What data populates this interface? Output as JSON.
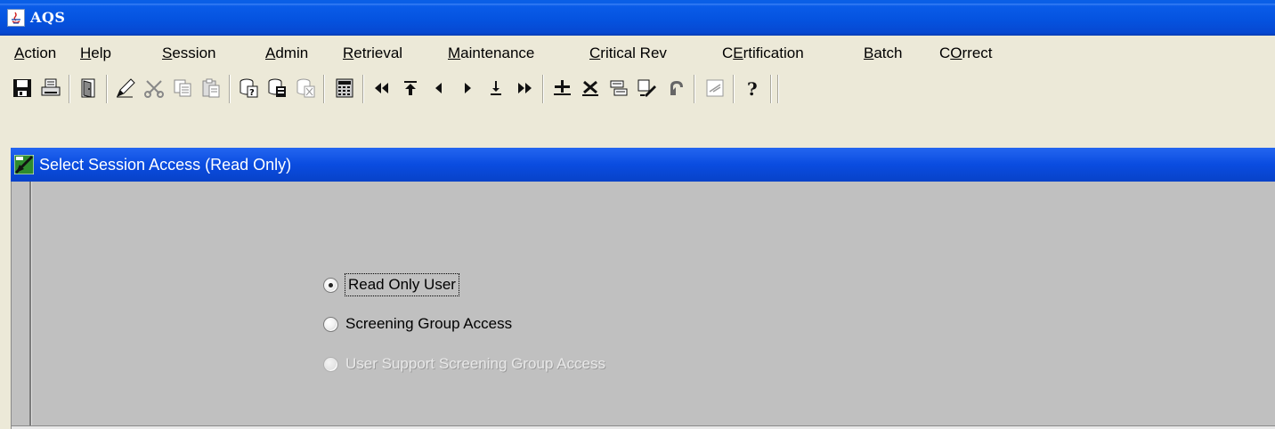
{
  "window": {
    "title": "AQS",
    "app_icon": "java-app-icon"
  },
  "menu": [
    {
      "mnemonic": "A",
      "rest": "ction"
    },
    {
      "mnemonic": "H",
      "rest": "elp"
    },
    {
      "mnemonic": "S",
      "rest": "ession"
    },
    {
      "mnemonic": "A",
      "rest": "dmin"
    },
    {
      "mnemonic": "R",
      "rest": "etrieval"
    },
    {
      "mnemonic": "M",
      "rest": "aintenance"
    },
    {
      "mnemonic": "C",
      "rest": "ritical Rev"
    },
    {
      "prefix": "C",
      "mnemonic": "E",
      "rest": "rtification"
    },
    {
      "mnemonic": "B",
      "rest": "atch"
    },
    {
      "prefix": "C",
      "mnemonic": "O",
      "rest": "rrect"
    }
  ],
  "toolbar": {
    "icons": [
      "save-icon",
      "print-icon",
      "exit-door-icon",
      "edit-pencil-icon",
      "cut-icon",
      "copy-icon",
      "paste-icon",
      "query-enter-icon",
      "query-execute-icon",
      "query-cancel-icon",
      "calculator-icon",
      "first-record-icon",
      "scroll-top-icon",
      "previous-record-icon",
      "next-record-icon",
      "scroll-bottom-icon",
      "last-record-icon",
      "insert-record-icon",
      "delete-record-icon",
      "duplicate-record-icon",
      "clear-record-icon",
      "undo-icon",
      "list-values-icon",
      "help-question-icon"
    ]
  },
  "form": {
    "title": "Select Session Access (Read Only)",
    "options": [
      {
        "label": "Read Only User",
        "checked": true,
        "enabled": true,
        "focused": true
      },
      {
        "label": "Screening Group Access",
        "checked": false,
        "enabled": true,
        "focused": false
      },
      {
        "label": "User Support Screening Group Access",
        "checked": false,
        "enabled": false,
        "focused": false
      }
    ]
  },
  "colors": {
    "title_bar": "#0553e0",
    "inner_title_bar": "#0a4ce0",
    "form_background": "#c0c0c0",
    "chrome_background": "#ece9d8"
  }
}
